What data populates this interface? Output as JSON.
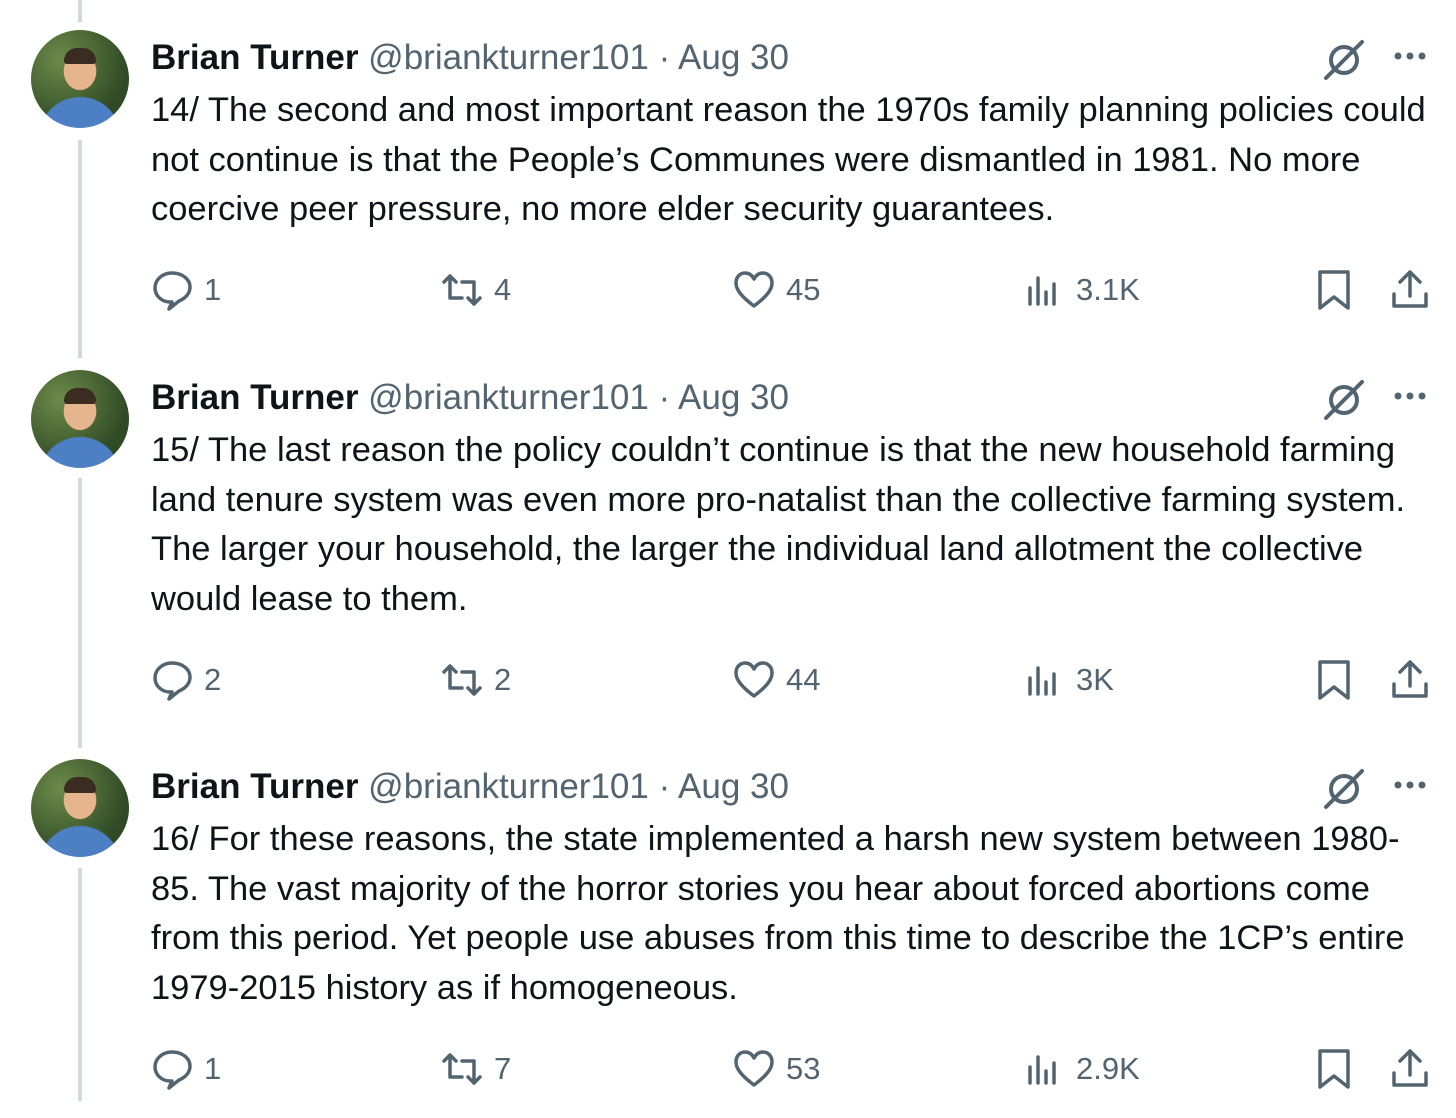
{
  "tweets": [
    {
      "author": "Brian Turner",
      "handle": "@briankturner101",
      "separator": "·",
      "date": "Aug 30",
      "text": "14/ The second and most important reason the 1970s family planning policies could not continue is that the People’s Communes were dismantled in 1981. No more coercive peer pressure, no more elder security guarantees.",
      "replies": "1",
      "reposts": "4",
      "likes": "45",
      "views": "3.1K"
    },
    {
      "author": "Brian Turner",
      "handle": "@briankturner101",
      "separator": "·",
      "date": "Aug 30",
      "text": "15/ The last reason the policy couldn’t continue is that the new household farming land tenure system was even more pro-natalist than the collective farming system. The larger your household, the larger the individual land allotment the collective would lease to them.",
      "replies": "2",
      "reposts": "2",
      "likes": "44",
      "views": "3K"
    },
    {
      "author": "Brian Turner",
      "handle": "@briankturner101",
      "separator": "·",
      "date": "Aug 30",
      "text": "16/ For these reasons, the state implemented a harsh new system between 1980-85. The vast majority of the horror stories you hear about forced abortions come from this period. Yet people use abuses from this time to describe the 1CP’s entire 1979-2015 history as if homogeneous.",
      "replies": "1",
      "reposts": "7",
      "likes": "53",
      "views": "2.9K"
    }
  ],
  "icons": {
    "grok": "grok-icon",
    "more": "more-icon",
    "reply": "reply-icon",
    "repost": "repost-icon",
    "like": "heart-icon",
    "views": "views-icon",
    "bookmark": "bookmark-icon",
    "share": "share-icon"
  },
  "colors": {
    "text": "#0f1419",
    "muted": "#536471",
    "thread_line": "#cfd9de"
  }
}
